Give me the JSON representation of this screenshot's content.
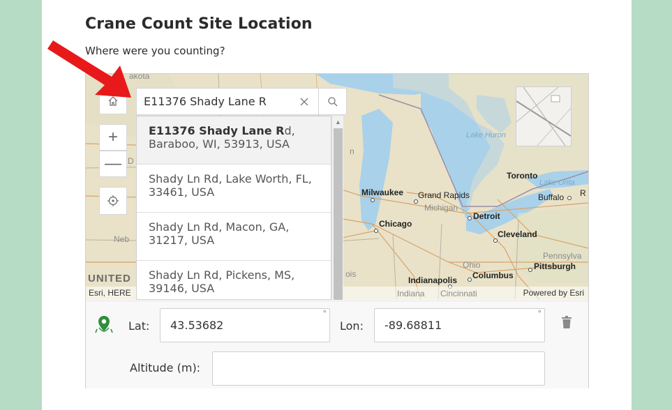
{
  "page": {
    "title": "Crane Count Site Location",
    "subtitle": "Where were you counting?"
  },
  "search": {
    "value": "E11376 Shady Lane R",
    "suggestions": [
      {
        "bold": "E11376 Shady Lane R",
        "rest": "d,",
        "line2": "Baraboo, WI, 53913, USA"
      },
      {
        "bold": "",
        "rest": "Shady Ln Rd, Lake Worth, FL,",
        "line2": "33461, USA"
      },
      {
        "bold": "",
        "rest": "Shady Ln Rd, Macon, GA,",
        "line2": "31217, USA"
      },
      {
        "bold": "",
        "rest": "Shady Ln Rd, Pickens, MS,",
        "line2": "39146, USA"
      }
    ]
  },
  "map": {
    "labels": {
      "lake_huron": "Lake Huron",
      "toronto": "Toronto",
      "lake_ontario": "Lake Onta",
      "milwaukee": "Milwaukee",
      "grand_rapids": "Grand Rapids",
      "michigan": "Michigan",
      "buffalo": "Buffalo",
      "r": "R",
      "detroit": "Detroit",
      "chicago": "Chicago",
      "cleveland": "Cleveland",
      "neb": "Neb",
      "pennsylv": "Pennsylva",
      "ohio": "Ohio",
      "pittsburgh": "Pittsburgh",
      "united": "UNITED",
      "indianapolis": "Indianapolis",
      "columbus": "Columbus",
      "cincinnati": "Cincinnati",
      "indiana": "Indiana",
      "ois": "ois",
      "d": "D",
      "akota": "akota",
      "n": "n"
    },
    "attribution_left": "Esri, HERE",
    "attribution_right": "Powered by Esri"
  },
  "coords": {
    "lat_label": "Lat:",
    "lat_value": "43.53682",
    "lon_label": "Lon:",
    "lon_value": "-89.68811",
    "alt_label": "Altitude (m):",
    "alt_value": "",
    "degree": "°"
  },
  "colors": {
    "background": "#b7dcc6",
    "water": "#a9d1ea",
    "land": "#e9e2c8",
    "pin": "#2f8f3a",
    "arrow": "#e8191a"
  }
}
